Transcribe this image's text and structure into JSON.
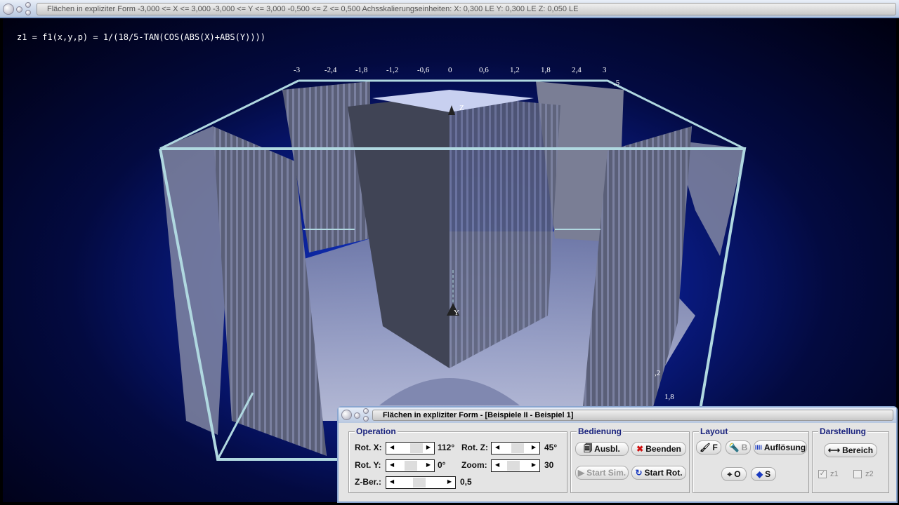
{
  "window": {
    "title": "Flächen in expliziter Form   -3,000 <= X <= 3,000   -3,000 <= Y <= 3,000   -0,500 <= Z <= 0,500   Achsskalierungseinheiten:  X: 0,300 LE    Y: 0,300 LE    Z: 0,050 LE"
  },
  "formula": "z1 = f1(x,y,p) = 1/(18/5-TAN(COS(ABS(X)+ABS(Y))))",
  "axis": {
    "x_ticks": [
      "-3",
      "-2,4",
      "-1,8",
      "-1,2",
      "-0,6",
      "0",
      "0,6",
      "1,2",
      "1,8",
      "2,4",
      "3"
    ],
    "z_label": "Z",
    "y_label": "Y",
    "partial_top": ",5",
    "side_ticks": [
      ",2",
      "1,8"
    ]
  },
  "colors": {
    "accent": "#1a237e",
    "background": "#0a1e90",
    "frame": "#b0d8e0"
  },
  "panel": {
    "title": "Flächen in expliziter Form - [Beispiele II - Beispiel 1]",
    "operation": {
      "label": "Operation",
      "rot_x_label": "Rot. X:",
      "rot_x_value": "112°",
      "rot_y_label": "Rot. Y:",
      "rot_y_value": "0°",
      "rot_z_label": "Rot. Z:",
      "rot_z_value": "45°",
      "zoom_label": "Zoom:",
      "zoom_value": "30",
      "zber_label": "Z-Ber.:",
      "zber_value": "0,5"
    },
    "bedienung": {
      "label": "Bedienung",
      "ausbl": "Ausbl.",
      "beenden": "Beenden",
      "start_sim": "Start Sim.",
      "start_rot": "Start Rot."
    },
    "layout": {
      "label": "Layout",
      "f": "F",
      "b": "B",
      "aufloesung": "Auflösung",
      "o": "O",
      "s": "S"
    },
    "darstellung": {
      "label": "Darstellung",
      "bereich": "Bereich",
      "z1": "z1",
      "z2": "z2",
      "z1_checked": true,
      "z2_checked": false
    }
  }
}
